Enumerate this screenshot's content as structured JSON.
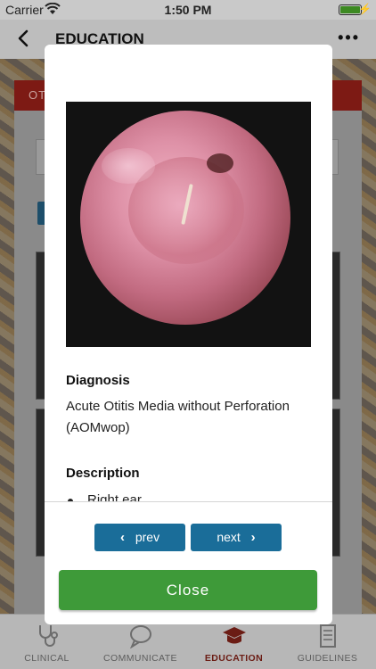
{
  "status_bar": {
    "carrier": "Carrier",
    "time": "1:50 PM"
  },
  "nav": {
    "title": "EDUCATION",
    "more_label": "•••"
  },
  "background": {
    "section_label": "OT"
  },
  "modal": {
    "diagnosis_heading": "Diagnosis",
    "diagnosis_text": "Acute Otitis Media without Perforation (AOMwop)",
    "description_heading": "Description",
    "description_items": [
      "Right ear"
    ],
    "prev_label": "prev",
    "next_label": "next",
    "close_label": "Close"
  },
  "tabs": [
    {
      "label": "CLINICAL",
      "icon": "stethoscope-icon",
      "active": false
    },
    {
      "label": "COMMUNICATE",
      "icon": "speech-bubble-icon",
      "active": false
    },
    {
      "label": "EDUCATION",
      "icon": "graduation-cap-icon",
      "active": true
    },
    {
      "label": "GUIDELINES",
      "icon": "document-icon",
      "active": false
    }
  ],
  "colors": {
    "accent_blue": "#1a6d99",
    "close_green": "#3e9a39",
    "header_red": "#7d1a14",
    "active_tab": "#6b1c14"
  }
}
